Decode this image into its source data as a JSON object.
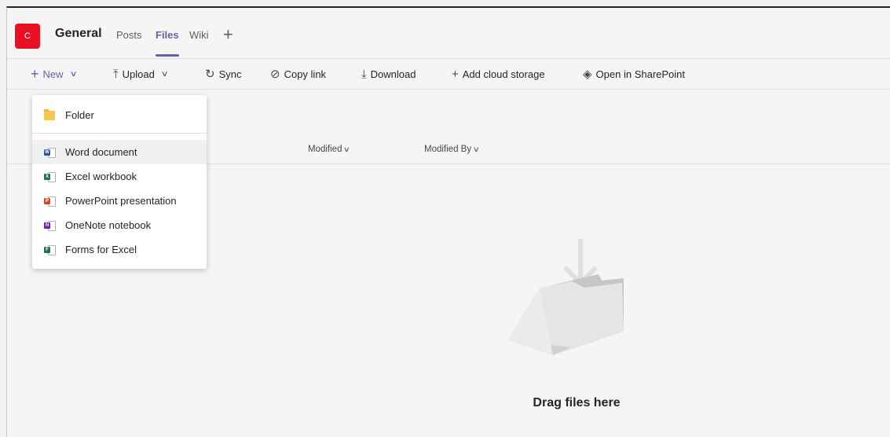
{
  "header": {
    "team_initial": "C",
    "channel": "General",
    "tabs": [
      {
        "label": "Posts"
      },
      {
        "label": "Files"
      },
      {
        "label": "Wiki"
      }
    ],
    "add_tab": "+"
  },
  "toolbar": {
    "new": "New",
    "upload": "Upload",
    "sync": "Sync",
    "copy_link": "Copy link",
    "download": "Download",
    "add_cloud_storage": "Add cloud storage",
    "open_in_sharepoint": "Open in SharePoint"
  },
  "columns": {
    "modified": "Modified",
    "modified_by": "Modified By"
  },
  "new_menu": {
    "items": [
      {
        "label": "Folder",
        "icon": "folder-icon"
      },
      {
        "label": "Word document",
        "icon": "word-icon"
      },
      {
        "label": "Excel workbook",
        "icon": "excel-icon"
      },
      {
        "label": "PowerPoint presentation",
        "icon": "powerpoint-icon"
      },
      {
        "label": "OneNote notebook",
        "icon": "onenote-icon"
      },
      {
        "label": "Forms for Excel",
        "icon": "forms-excel-icon"
      }
    ]
  },
  "empty_state": {
    "text": "Drag files here"
  },
  "colors": {
    "accent": "#6264a7",
    "team_avatar": "#e81123",
    "word": "#2b579a",
    "excel": "#217346",
    "powerpoint": "#d24726",
    "onenote": "#7719aa",
    "folder": "#f2c94c"
  }
}
